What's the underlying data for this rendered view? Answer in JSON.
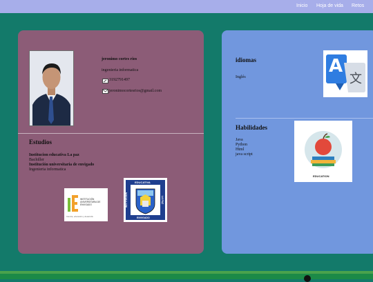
{
  "nav": {
    "inicio": "Inicio",
    "hoja": "Hoja de vida",
    "retos": "Retos"
  },
  "profile": {
    "name": "jeronimo cortes rios",
    "career": "ingenieria informatica",
    "phone": "3192791497",
    "email": "jeronimocortesrios@gmail.com"
  },
  "estudios": {
    "heading": "Estudios",
    "items": [
      {
        "school": "Institucion educativa La paz",
        "degree": "Bachiller"
      },
      {
        "school": "Institución universitaria de envigado",
        "degree": "Ingenieria informatica"
      }
    ],
    "logo1_text": "INSTITUCIÓN UNIVERSITARIA DE ENVIGADO",
    "logo1_tagline": "Ciencia, educación y desarrollo",
    "logo2_text_top": "EDUCATIVA",
    "logo2_text_left": "INSTITUCIÓN",
    "logo2_text_right": "LA PAZ",
    "logo2_text_bottom": "ENVIGADO"
  },
  "idiomas": {
    "heading": "idiomas",
    "items": [
      "Inglés"
    ],
    "icon_letter": "A",
    "icon_char": "文"
  },
  "habilidades": {
    "heading": "Habilidades",
    "items": [
      "Java",
      "Python",
      "Html",
      "java script"
    ],
    "badge_text": "EDUCATION"
  },
  "colors": {
    "page_bg": "#137a6a",
    "topbar": "#a7aeea",
    "left_card": "#8c5c77",
    "right_card": "#7197de",
    "footer": "#1c8a47"
  }
}
